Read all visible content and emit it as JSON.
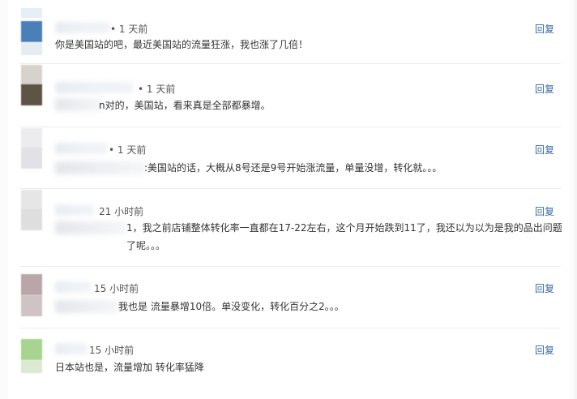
{
  "comments": [
    {
      "time": "• 1 天前",
      "text": "你是美国站的吧，最近美国站的流量狂涨，我也涨了几倍！",
      "reply": "回复",
      "avatar_colors": [
        "#4a7fb8",
        "#dce6f0"
      ]
    },
    {
      "time": "• 1 天前",
      "text": "n对的，美国站，看来真是全部都暴增。",
      "reply": "回复",
      "avatar_colors": [
        "#5e5445",
        "#d7d2cc"
      ]
    },
    {
      "time": "• 1 天前",
      "text": ":美国站的话，大概从8号还是9号开始涨流量，单量没增，转化就。。。",
      "reply": "回复",
      "avatar_colors": [
        "#e2e2e6",
        "#eeeef0"
      ]
    },
    {
      "time": "21 小时前",
      "text": "1，我之前店铺整体转化率一直都在17-22左右，这个月开始跌到11了，我还以为以为是我的品出问题了呢。。。",
      "reply": "回复",
      "avatar_colors": [
        "#dedede",
        "#e9e9e9"
      ]
    },
    {
      "time": "15 小时前",
      "text": "我也是 流量暴增10倍。单没变化，转化百分之2。。。",
      "reply": "回复",
      "avatar_colors": [
        "#b9a6a8",
        "#cfc3c5"
      ]
    },
    {
      "time": "15 小时前",
      "text": "日本站也是，流量增加 转化率猛降",
      "reply": "回复",
      "avatar_colors": [
        "#a7d48f",
        "#dbe8d2"
      ]
    }
  ]
}
